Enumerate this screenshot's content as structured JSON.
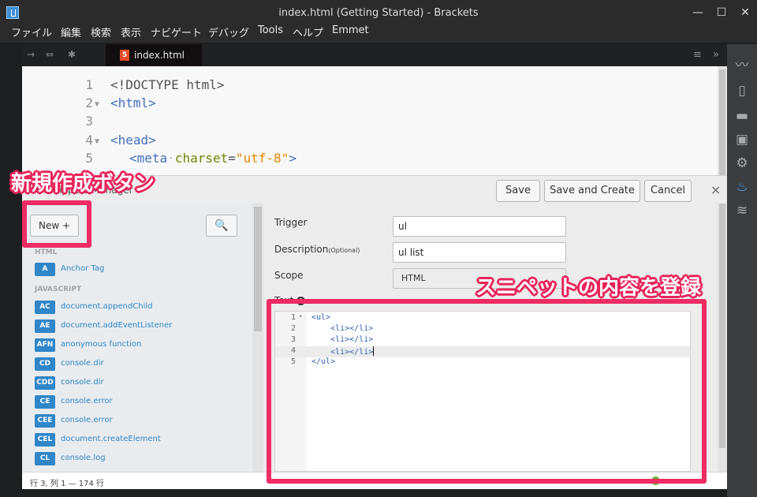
{
  "window": {
    "title": "index.html (Getting Started) - Brackets"
  },
  "menu": [
    "ファイル",
    "編集",
    "検索",
    "表示",
    "ナビゲート",
    "デバッグ",
    "Tools",
    "ヘルプ",
    "Emmet"
  ],
  "tab": {
    "file_name": "index.html",
    "file_type": "5"
  },
  "editor": {
    "lines": [
      {
        "n": "1",
        "text": "<!DOCTYPE html>"
      },
      {
        "n": "2",
        "text": "<html>"
      },
      {
        "n": "3",
        "text": ""
      },
      {
        "n": "4",
        "text": "<head>"
      },
      {
        "n": "5",
        "meta_tag": "<meta",
        "meta_attr": "charset",
        "meta_val": "\"utf-8\"",
        "meta_close": ">"
      }
    ]
  },
  "panel": {
    "title": "Snippets Manager",
    "save_label": "Save",
    "save_create_label": "Save and Create",
    "cancel_label": "Cancel",
    "close_glyph": "×"
  },
  "list": {
    "new_label": "New +",
    "search_glyph": "🔍",
    "html_category": "HTML",
    "js_category": "JAVASCRIPT",
    "html_items": [
      {
        "badge": "A",
        "name": "Anchor Tag"
      }
    ],
    "js_items": [
      {
        "badge": "AC",
        "name": "document.appendChild"
      },
      {
        "badge": "AE",
        "name": "document.addEventListener"
      },
      {
        "badge": "AFN",
        "name": "anonymous function"
      },
      {
        "badge": "CD",
        "name": "console.dir"
      },
      {
        "badge": "CDD",
        "name": "console.dir"
      },
      {
        "badge": "CE",
        "name": "console.error"
      },
      {
        "badge": "CEE",
        "name": "console.error"
      },
      {
        "badge": "CEL",
        "name": "document.createElement"
      },
      {
        "badge": "CL",
        "name": "console.log"
      }
    ]
  },
  "form": {
    "trigger_label": "Trigger",
    "trigger_value": "ul",
    "description_label": "Description",
    "description_optional": "(Optional)",
    "description_value": "ul list",
    "scope_label": "Scope",
    "scope_value": "HTML",
    "text_label": "Text",
    "text_lines": [
      {
        "n": "1",
        "code": "<ul>",
        "fold": "▾"
      },
      {
        "n": "2",
        "code": "    <li></li>"
      },
      {
        "n": "3",
        "code": "    <li></li>"
      },
      {
        "n": "4",
        "code": "    <li></li>"
      },
      {
        "n": "5",
        "code": "</ul>"
      }
    ]
  },
  "status": {
    "position": "行 3, 列 1 — 174 行"
  },
  "annotations": {
    "new_button_note": "新規作成ボタン",
    "content_note": "スニペットの内容を登録"
  },
  "colors": {
    "annotation": "#ee2b64",
    "badge": "#2f86c8",
    "tag": "#446fbd",
    "attr": "#6d8600",
    "string": "#e88501"
  }
}
